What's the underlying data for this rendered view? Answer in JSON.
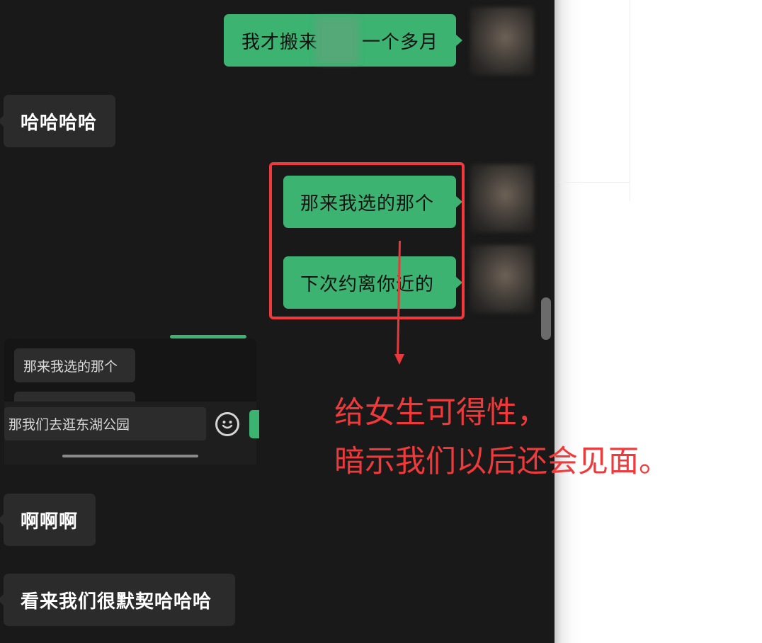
{
  "messages": [
    {
      "dir": "out",
      "text": "我才搬来",
      "text_after": "一个多月",
      "blurred_segment": true
    },
    {
      "dir": "in",
      "text": "哈哈哈哈"
    },
    {
      "dir": "out",
      "text": "那来我选的那个"
    },
    {
      "dir": "out",
      "text": "下次约离你近的"
    },
    {
      "dir": "in",
      "text": "啊啊啊"
    },
    {
      "dir": "in",
      "text": "看来我们很默契哈哈哈"
    }
  ],
  "reply_popup": {
    "quoted_text": "那来我选的那个",
    "input_text": "那我们去逛东湖公园",
    "emoji_icon": "smiley-icon"
  },
  "annotation": {
    "line1": "给女生可得性，",
    "line2": "暗示我们以后还会见面。",
    "color": "#f0393a"
  },
  "colors": {
    "outgoing_bubble": "#3cb371",
    "incoming_bubble": "#2b2b2b",
    "chat_background": "#191919",
    "highlight": "#f2383a"
  }
}
